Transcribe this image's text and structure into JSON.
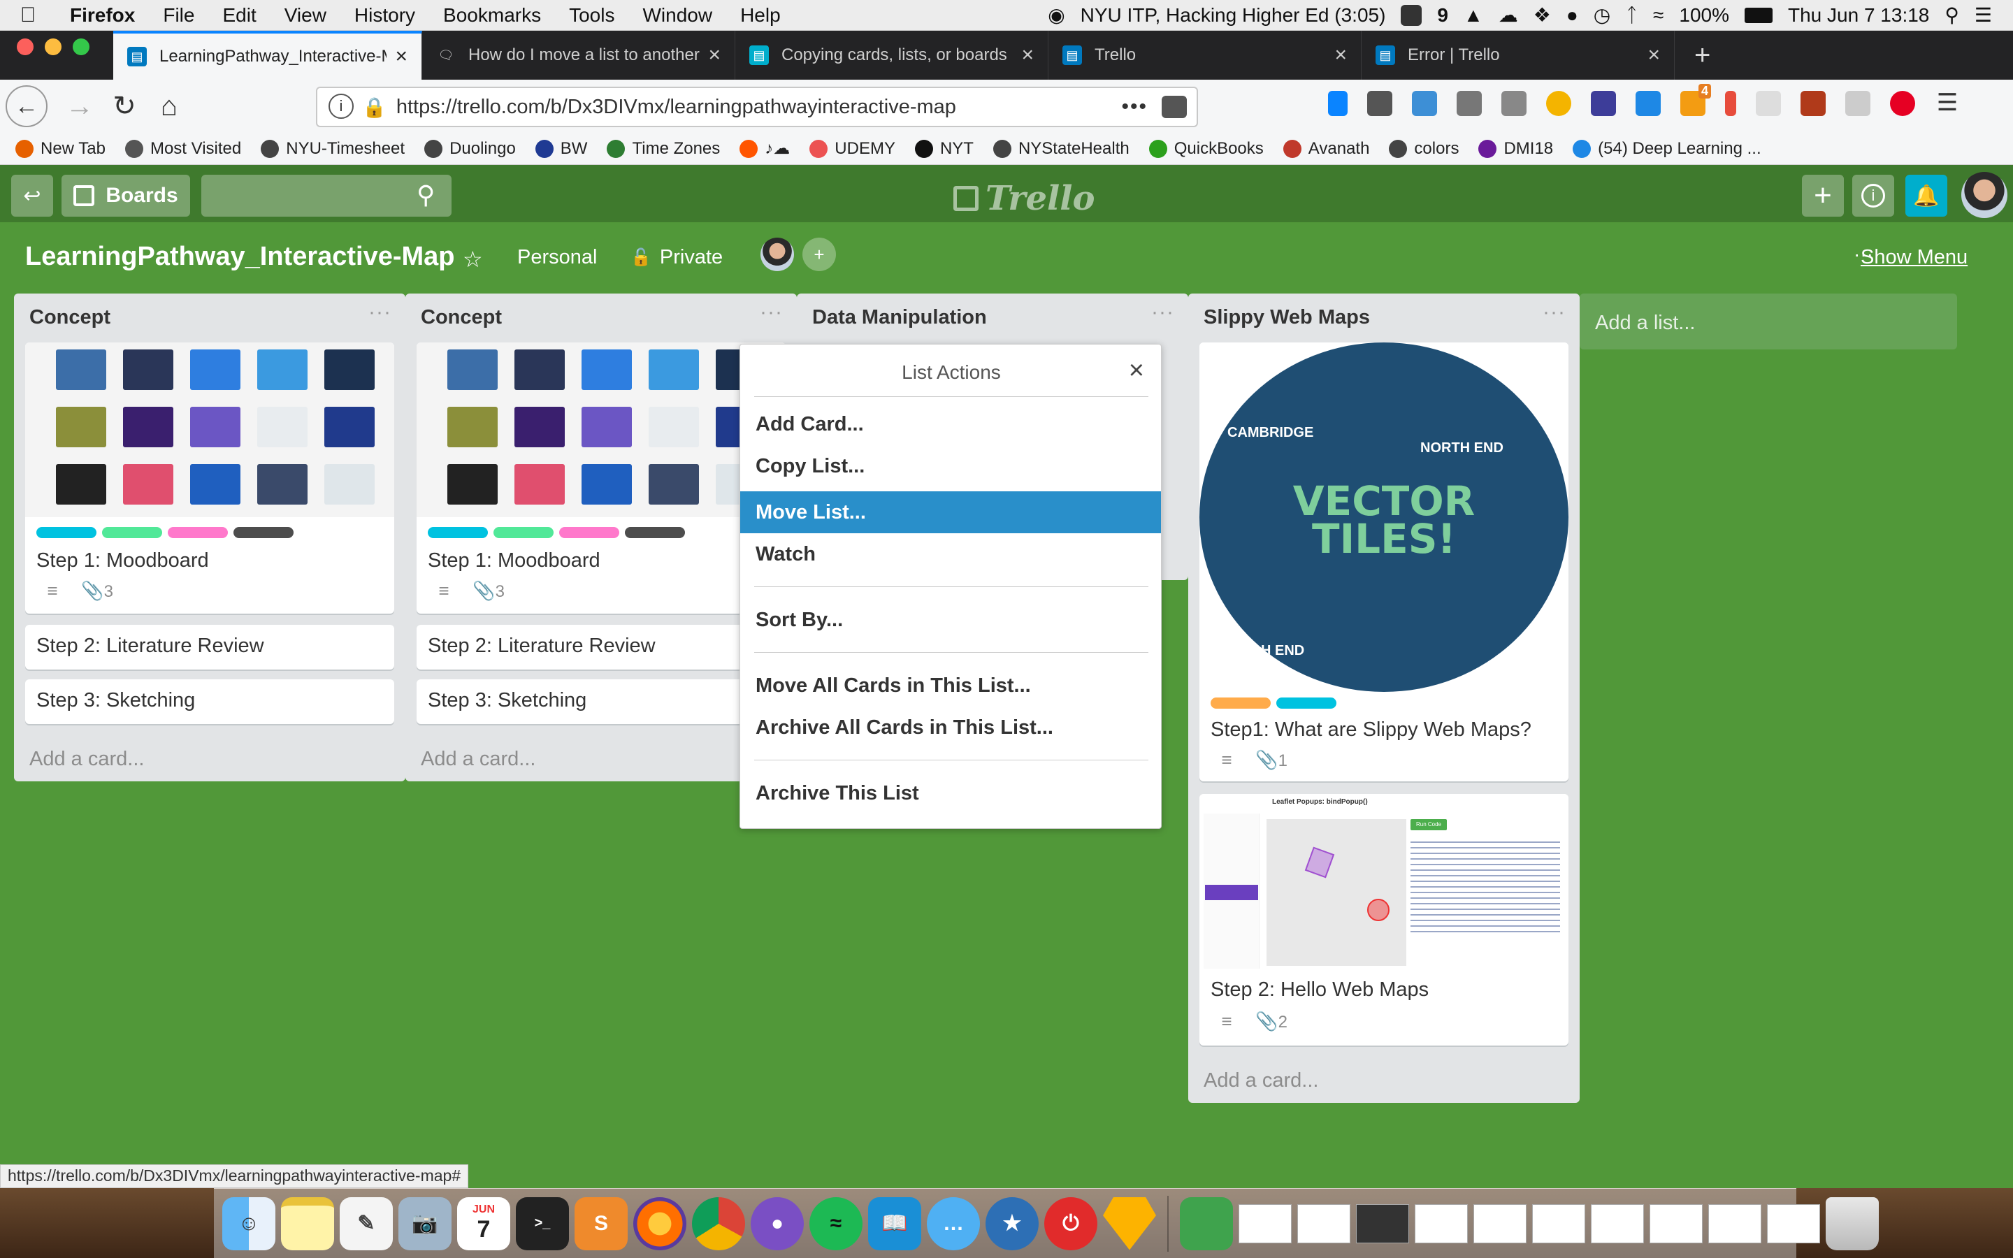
{
  "menubar": {
    "app_name": "Firefox",
    "items": [
      "File",
      "Edit",
      "View",
      "History",
      "Bookmarks",
      "Tools",
      "Window",
      "Help"
    ],
    "now_playing": "NYU ITP, Hacking Higher Ed (3:05)",
    "badge_count": "9",
    "battery": "100%",
    "clock": "Thu Jun 7  13:18"
  },
  "tabs": [
    {
      "label": "LearningPathway_Interactive-M",
      "active": true
    },
    {
      "label": "How do I move a list to another",
      "active": false
    },
    {
      "label": "Copying cards, lists, or boards",
      "active": false
    },
    {
      "label": "Trello",
      "active": false
    },
    {
      "label": "Error | Trello",
      "active": false
    }
  ],
  "nav": {
    "url": "https://trello.com/b/Dx3DIVmx/learningpathwayinteractive-map",
    "more": "•••",
    "ext_badge": "4"
  },
  "bookmarks": [
    {
      "label": "New Tab",
      "color": "#e66000"
    },
    {
      "label": "Most Visited",
      "color": "#555555"
    },
    {
      "label": "NYU-Timesheet",
      "color": "#444444"
    },
    {
      "label": "Duolingo",
      "color": "#444444"
    },
    {
      "label": "BW",
      "color": "#1f3a93"
    },
    {
      "label": "Time Zones",
      "color": "#2e7d32"
    },
    {
      "label": "♪☁",
      "color": "#ff5500"
    },
    {
      "label": "UDEMY",
      "color": "#ec5252"
    },
    {
      "label": "NYT",
      "color": "#111111"
    },
    {
      "label": "NYStateHealth",
      "color": "#444444"
    },
    {
      "label": "QuickBooks",
      "color": "#2ca01c"
    },
    {
      "label": "Avanath",
      "color": "#c0392b"
    },
    {
      "label": "colors",
      "color": "#444444"
    },
    {
      "label": "DMI18",
      "color": "#6a1b9a"
    },
    {
      "label": "(54) Deep Learning ...",
      "color": "#1e88e5"
    }
  ],
  "trello": {
    "boards_label": "Boards",
    "logo_text": "Trello",
    "board_title": "LearningPathway_Interactive-Map",
    "team": "Personal",
    "visibility": "Private",
    "show_menu": "Show Menu",
    "add_list": "Add a list..."
  },
  "lists": [
    {
      "title": "Concept",
      "cards": [
        {
          "title": "Step 1: Moodboard",
          "labels": [
            "#00c2e0",
            "#51e898",
            "#ff78cb",
            "#4d4d4d"
          ],
          "attachments": "3"
        },
        {
          "title": "Step 2: Literature Review"
        },
        {
          "title": "Step 3: Sketching"
        }
      ],
      "add_card": "Add a card..."
    },
    {
      "title": "Concept",
      "cards": [
        {
          "title": "Step 1: Moodboard",
          "labels": [
            "#00c2e0",
            "#51e898",
            "#ff78cb",
            "#4d4d4d"
          ],
          "attachments": "3"
        },
        {
          "title": "Step 2: Literature Review"
        },
        {
          "title": "Step 3: Sketching"
        }
      ],
      "add_card": "Add a card..."
    },
    {
      "title": "Data Manipulation"
    },
    {
      "title": "Slippy Web Maps",
      "cards": [
        {
          "title": "Step1: What are Slippy Web Maps?",
          "labels": [
            "#ffab4a",
            "#00c2e0"
          ],
          "attachments": "1",
          "image_text": [
            "VECTOR",
            "TILES!"
          ],
          "map_labels": [
            "CAMBRIDGE",
            "NORTH END",
            "H END"
          ]
        },
        {
          "title": "Step 2: Hello Web Maps",
          "attachments": "2",
          "image_heading": "Leaflet Popups: bindPopup()",
          "image_button": "Run Code"
        }
      ],
      "add_card": "Add a card..."
    }
  ],
  "popover": {
    "title": "List Actions",
    "close": "×",
    "items": [
      "Add Card...",
      "Copy List...",
      "Move List...",
      "Watch",
      "Sort By...",
      "Move All Cards in This List...",
      "Archive All Cards in This List...",
      "Archive This List"
    ],
    "highlighted": "Move List..."
  },
  "statusbar": {
    "link": "https://trello.com/b/Dx3DIVmx/learningpathwayinteractive-map#"
  },
  "dock": {
    "calendar_month": "JUN",
    "calendar_day": "7"
  }
}
